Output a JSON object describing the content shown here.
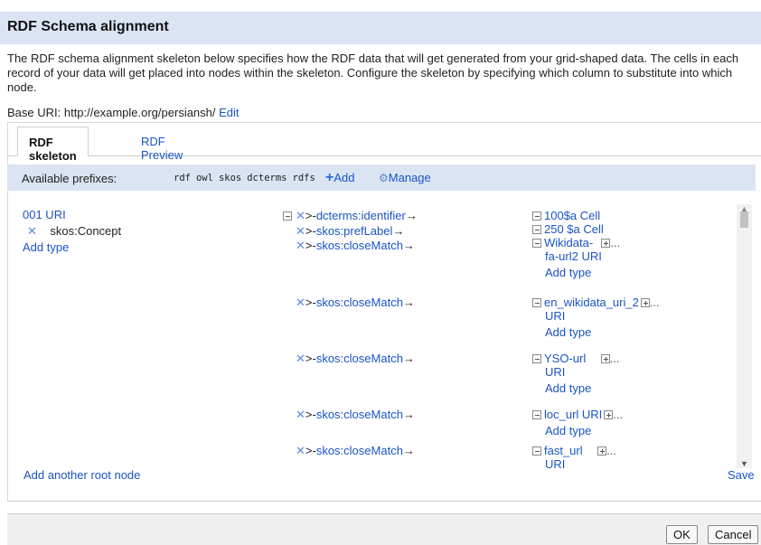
{
  "dialog": {
    "title": "RDF Schema alignment",
    "description": "The RDF schema alignment skeleton below specifies how the RDF data that will get generated from your grid-shaped data. The cells in each record of your data will get placed into nodes within the skeleton. Configure the skeleton by specifying which column to substitute into which node.",
    "base_uri_label": "Base URI: http://example.org/persiansh/",
    "base_uri_edit": "Edit"
  },
  "tabs": [
    {
      "label": "RDF skeleton",
      "active": true
    },
    {
      "label": "RDF Preview",
      "active": false
    }
  ],
  "prefixes": {
    "label": "Available prefixes:",
    "items": [
      "rdf",
      "owl",
      "skos",
      "dcterms",
      "rdfs"
    ],
    "add_label": "Add",
    "manage_label": "Manage"
  },
  "root_node": {
    "label": "001 URI",
    "type": "skos:Concept",
    "add_type": "Add type"
  },
  "properties": [
    {
      "name": "dcterms:identifier",
      "target_line1": "100$a Cell",
      "target_line2": "",
      "add_type": "",
      "expandable": false
    },
    {
      "name": "skos:prefLabel",
      "target_line1": "250 $a Cell",
      "target_line2": "",
      "add_type": "",
      "expandable": false
    },
    {
      "name": "skos:closeMatch",
      "target_line1": "Wikidata-",
      "target_line2": "fa-url2 URI",
      "add_type": "Add type",
      "expandable": true
    },
    {
      "name": "skos:closeMatch",
      "target_line1": "en_wikidata_uri_2",
      "target_line2": "URI",
      "add_type": "Add type",
      "expandable": true
    },
    {
      "name": "skos:closeMatch",
      "target_line1": "YSO-url",
      "target_line2": "URI",
      "add_type": "Add type",
      "expandable": true
    },
    {
      "name": "skos:closeMatch",
      "target_line1": "loc_url URI",
      "target_line2": "",
      "add_type": "Add type",
      "expandable": true
    },
    {
      "name": "skos:closeMatch",
      "target_line1": "fast_url",
      "target_line2": "URI",
      "add_type": "",
      "expandable": true
    }
  ],
  "ellipsis": "...",
  "footer_links": {
    "add_root": "Add another root node",
    "save": "Save"
  },
  "buttons": {
    "ok": "OK",
    "cancel": "Cancel"
  }
}
